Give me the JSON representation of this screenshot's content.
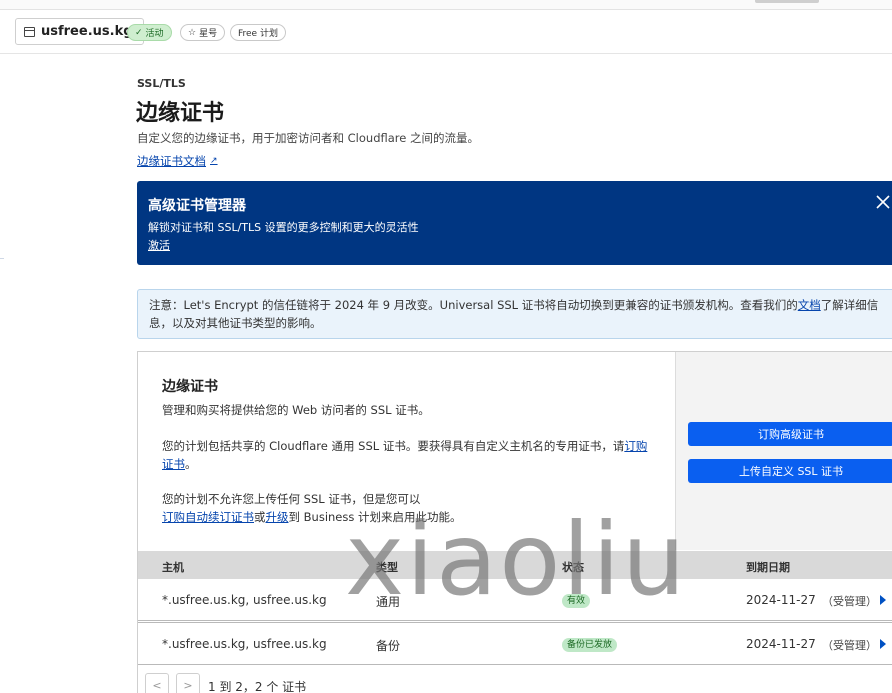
{
  "header": {
    "domain": "usfree.us.kg",
    "status_badge": "活动",
    "star_badge": "星号",
    "plan_badge": "Free 计划"
  },
  "page": {
    "breadcrumb": "SSL/TLS",
    "title": "边缘证书",
    "description": "自定义您的边缘证书，用于加密访问者和 Cloudflare 之间的流量。",
    "doc_link": "边缘证书文档"
  },
  "promo": {
    "title": "高级证书管理器",
    "description": "解锁对证书和 SSL/TLS 设置的更多控制和更大的灵活性",
    "link": "激活"
  },
  "notice": {
    "text_before": "注意：Let's Encrypt 的信任链将于 2024 年 9 月改变。Universal SSL 证书将自动切换到更兼容的证书颁发机构。查看我们的",
    "link": "文档",
    "text_after": "了解详细信息，以及对其他证书类型的影响。"
  },
  "card": {
    "title": "边缘证书",
    "line1": "管理和购买将提供给您的 Web 访问者的 SSL 证书。",
    "line2_text": "您的计划包括共享的 Cloudflare 通用 SSL 证书。要获得具有自定义主机名的专用证书，请",
    "line2_link": "订购证书",
    "line2_end": "。",
    "line3_text": "您的计划不允许您上传任何 SSL 证书，但是您可以",
    "line3_link1": "订购自动续订证书",
    "line3_or": "或",
    "line3_link2": "升级",
    "line3_end": "到 Business 计划来启用此功能。",
    "btn_order": "订购高级证书",
    "btn_upload": "上传自定义 SSL 证书"
  },
  "table": {
    "headers": [
      "主机",
      "类型",
      "状态",
      "到期日期"
    ],
    "rows": [
      {
        "host": "*.usfree.us.kg, usfree.us.kg",
        "type": "通用",
        "status": "有效",
        "expires": "2024-11-27",
        "managed": "（受管理）"
      },
      {
        "host": "*.usfree.us.kg, usfree.us.kg",
        "type": "备份",
        "status": "备份已发放",
        "expires": "2024-11-27",
        "managed": "（受管理）"
      }
    ]
  },
  "pager": {
    "prev": "<",
    "next": ">",
    "summary": "1 到 2，2 个 证书"
  },
  "watermark": "xiaoliu",
  "colors": {
    "promo_bg": "#003682",
    "primary_button": "#0a5ff0",
    "link": "#0645ad",
    "active_badge": "#cfeecf"
  }
}
